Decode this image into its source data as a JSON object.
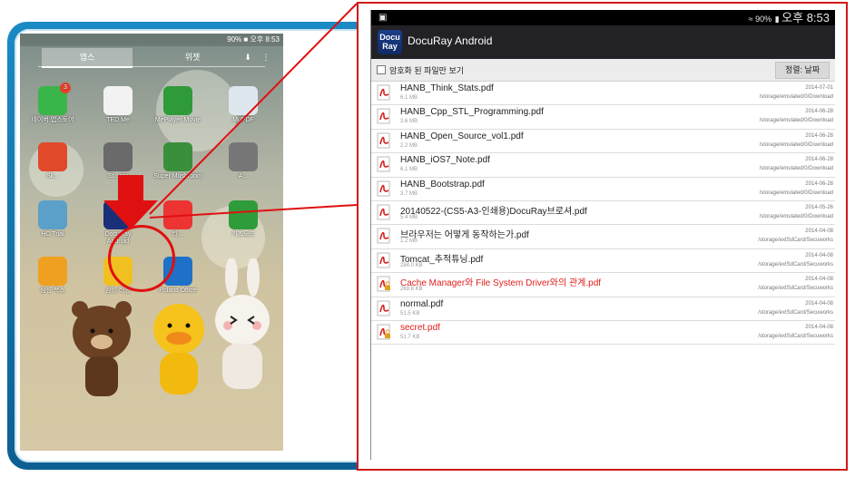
{
  "phone": {
    "status_time": "90% ■ 오후 8:53",
    "tabs": [
      "앱스",
      "위젯"
    ],
    "apps": [
      {
        "name": "APPS",
        "label": "네이버 앱스토어",
        "badge": "3",
        "color": "#39b54a"
      },
      {
        "name": "tedme",
        "label": "TED Me",
        "color": "#f2f2f2"
      },
      {
        "name": "meplayer",
        "label": "MePlayer Movie",
        "color": "#2f9a3a"
      },
      {
        "name": "mupdf",
        "label": "MuPDF",
        "color": "#dfe7ee"
      },
      {
        "name": "s",
        "label": "Sk...",
        "color": "#e04a2a"
      },
      {
        "name": "stardict",
        "label": "St...ary",
        "color": "#6a6a6a"
      },
      {
        "name": "mushroom",
        "label": "Super Mushroom",
        "color": "#3a8f3a"
      },
      {
        "name": "a",
        "label": "A...",
        "color": "#777"
      },
      {
        "name": "hc",
        "label": "HC Trial",
        "color": "#5aa0c8"
      },
      {
        "name": "docuray",
        "label": "DocuRay Android",
        "color": "#1b2f78"
      },
      {
        "name": "taxi",
        "label": "타...",
        "color": "#e33"
      },
      {
        "name": "kidsmode",
        "label": "키즈모드",
        "color": "#2e9c3a"
      },
      {
        "name": "book",
        "label": "삼성 북스",
        "color": "#f0a020"
      },
      {
        "name": "learn",
        "label": "삼성 러닝",
        "color": "#f0c020"
      },
      {
        "name": "polaris",
        "label": "Polaris Office",
        "color": "#1e70c8"
      }
    ],
    "dots": "— — — — — ▬"
  },
  "app": {
    "status_time": "오후 8:53",
    "status_battery": "90%",
    "logo_line1": "Docu",
    "logo_line2": "Ray",
    "title": "DocuRay Android",
    "filter_label": "암호화 된 파일만 보기",
    "sort_label": "정렬: 날짜",
    "files": [
      {
        "name": "HANB_Think_Stats.pdf",
        "size": "6.1 MB",
        "date": "2014-07-01",
        "path": "/storage/emulated/0/Download",
        "encrypted": false
      },
      {
        "name": "HANB_Cpp_STL_Programming.pdf",
        "size": "3.6 MB",
        "date": "2014-06-28",
        "path": "/storage/emulated/0/Download",
        "encrypted": false
      },
      {
        "name": "HANB_Open_Source_vol1.pdf",
        "size": "2.2 MB",
        "date": "2014-06-28",
        "path": "/storage/emulated/0/Download",
        "encrypted": false
      },
      {
        "name": "HANB_iOS7_Note.pdf",
        "size": "6.1 MB",
        "date": "2014-06-28",
        "path": "/storage/emulated/0/Download",
        "encrypted": false
      },
      {
        "name": "HANB_Bootstrap.pdf",
        "size": "3.7 MB",
        "date": "2014-06-28",
        "path": "/storage/emulated/0/Download",
        "encrypted": false
      },
      {
        "name": "20140522-(CS5-A3-인쇄용)DocuRay브로셔.pdf",
        "size": "5.4 MB",
        "date": "2014-05-26",
        "path": "/storage/emulated/0/Download",
        "encrypted": false
      },
      {
        "name": "브라우저는 어떻게 동작하는가.pdf",
        "size": "1.2 MB",
        "date": "2014-04-08",
        "path": "/storage/extSdCard/Secuworks",
        "encrypted": false
      },
      {
        "name": "Tomcat_추적튜닝.pdf",
        "size": "284.0 KB",
        "date": "2014-04-08",
        "path": "/storage/extSdCard/Secuworks",
        "encrypted": false
      },
      {
        "name": "Cache Manager와 File System Driver와의 관계.pdf",
        "size": "269.8 KB",
        "date": "2014-04-08",
        "path": "/storage/extSdCard/Secuworks",
        "encrypted": true
      },
      {
        "name": "normal.pdf",
        "size": "51.5 KB",
        "date": "2014-04-08",
        "path": "/storage/extSdCard/Secuworks",
        "encrypted": false
      },
      {
        "name": "secret.pdf",
        "size": "51.7 KB",
        "date": "2014-04-08",
        "path": "/storage/extSdCard/Secuworks",
        "encrypted": true
      }
    ]
  },
  "colors": {
    "frame_blue": "#1a8ac4",
    "highlight_red": "#e01010",
    "encrypted_text": "#e0201c",
    "titlebar": "#222226"
  }
}
